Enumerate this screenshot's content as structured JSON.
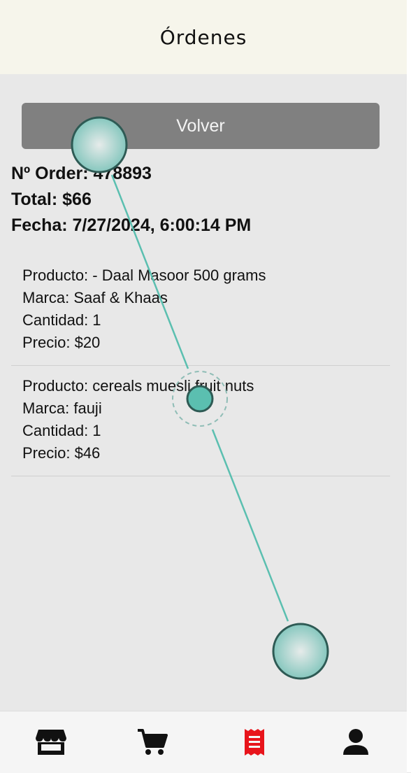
{
  "header": {
    "title": "Órdenes"
  },
  "back_button": {
    "label": "Volver"
  },
  "order": {
    "number_line": "Nº Order: 478893",
    "total_line": "Total: $66",
    "date_line": "Fecha: 7/27/2024, 6:00:14 PM"
  },
  "items": [
    {
      "product": "Producto: - Daal Masoor 500 grams",
      "brand": "Marca: Saaf & Khaas",
      "qty": "Cantidad: 1",
      "price": "Precio: $20"
    },
    {
      "product": "Producto: cereals muesli fruit nuts",
      "brand": "Marca: fauji",
      "qty": "Cantidad: 1",
      "price": "Precio: $46"
    }
  ],
  "bottom_nav": {
    "items": [
      {
        "icon": "store-icon",
        "active": false
      },
      {
        "icon": "cart-icon",
        "active": false
      },
      {
        "icon": "receipt-icon",
        "active": true
      },
      {
        "icon": "user-icon",
        "active": false
      }
    ],
    "active_color": "#e8141b",
    "inactive_color": "#111111"
  },
  "gesture_color": "#5bbfb0"
}
